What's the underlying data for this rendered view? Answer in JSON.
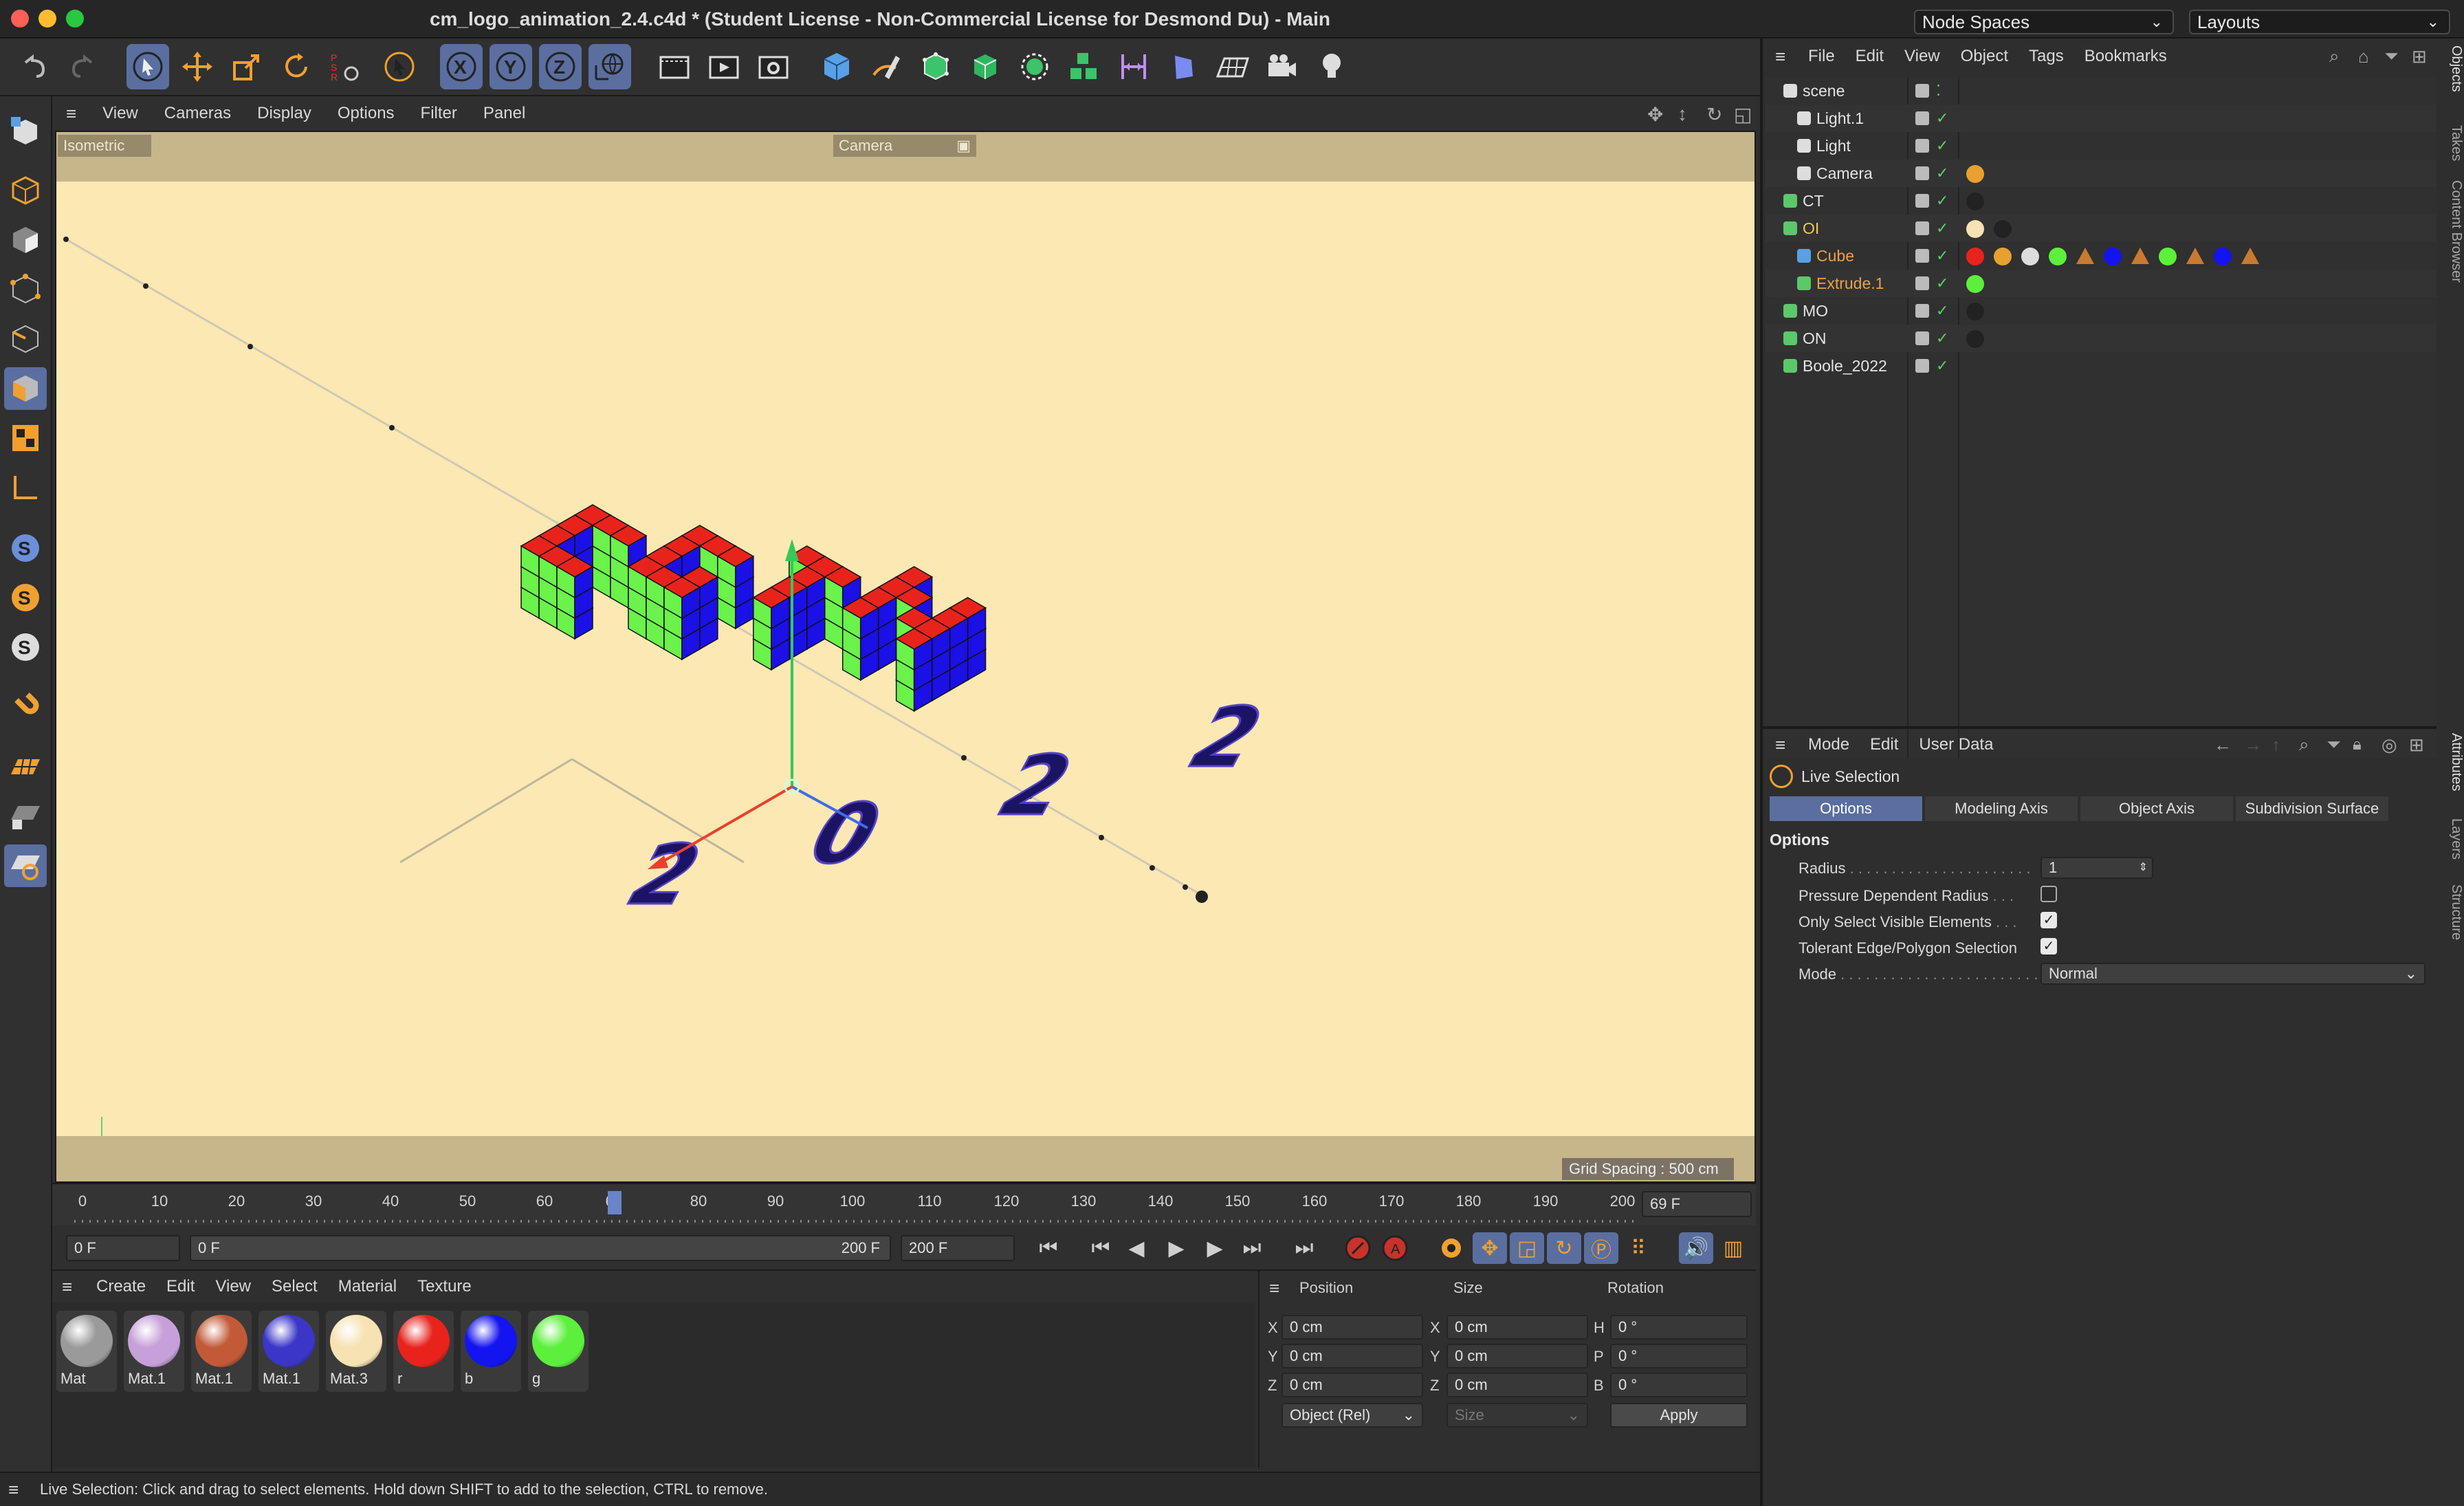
{
  "window": {
    "title": "cm_logo_animation_2.4.c4d * (Student License - Non-Commercial License for Desmond Du) - Main",
    "node_spaces": "Node Spaces",
    "layouts": "Layouts"
  },
  "viewport": {
    "menu": [
      "View",
      "Cameras",
      "Display",
      "Options",
      "Filter",
      "Panel"
    ],
    "projection": "Isometric",
    "camera": "Camera",
    "grid_spacing": "Grid Spacing : 500 cm",
    "logo_text": "2022",
    "colors": {
      "top": "#e8231c",
      "left": "#6bf24b",
      "right": "#1b10e6",
      "background": "#fbe8b2"
    }
  },
  "timeline": {
    "ticks": [
      "0",
      "10",
      "20",
      "30",
      "40",
      "50",
      "60",
      "69",
      "80",
      "90",
      "100",
      "110",
      "120",
      "130",
      "140",
      "150",
      "160",
      "170",
      "180",
      "190",
      "200"
    ],
    "current_frame": "69 F"
  },
  "playback": {
    "start": "0 F",
    "range_start": "0 F",
    "range_end": "200 F",
    "end": "200 F"
  },
  "materials": {
    "menu": [
      "Create",
      "Edit",
      "View",
      "Select",
      "Material",
      "Texture"
    ],
    "items": [
      {
        "name": "Mat",
        "color": "#9a9a9a"
      },
      {
        "name": "Mat.1",
        "color": "#c6a0d8"
      },
      {
        "name": "Mat.1",
        "color": "#c25a38"
      },
      {
        "name": "Mat.1",
        "color": "#3b36c8"
      },
      {
        "name": "Mat.3",
        "color": "#f6e2b2"
      },
      {
        "name": "r",
        "color": "#e8231c"
      },
      {
        "name": "b",
        "color": "#1414f0"
      },
      {
        "name": "g",
        "color": "#5cf03c"
      }
    ]
  },
  "coordinates": {
    "headers": [
      "Position",
      "Size",
      "Rotation"
    ],
    "rows": [
      {
        "axis": "X",
        "pos": "0 cm",
        "saxis": "X",
        "size": "0 cm",
        "raxis": "H",
        "rot": "0 °"
      },
      {
        "axis": "Y",
        "pos": "0 cm",
        "saxis": "Y",
        "size": "0 cm",
        "raxis": "P",
        "rot": "0 °"
      },
      {
        "axis": "Z",
        "pos": "0 cm",
        "saxis": "Z",
        "size": "0 cm",
        "raxis": "B",
        "rot": "0 °"
      }
    ],
    "mode": "Object (Rel)",
    "size_mode": "Size",
    "apply": "Apply"
  },
  "status": "Live Selection: Click and drag to select elements. Hold down SHIFT to add to the selection, CTRL to remove.",
  "objects": {
    "menu": [
      "File",
      "Edit",
      "View",
      "Object",
      "Tags",
      "Bookmarks"
    ],
    "rows": [
      {
        "name": "scene",
        "indent": 0,
        "color": "#e3e3e3"
      },
      {
        "name": "Light.1",
        "indent": 1,
        "color": "#e3e3e3"
      },
      {
        "name": "Light",
        "indent": 1,
        "color": "#e3e3e3"
      },
      {
        "name": "Camera",
        "indent": 1,
        "color": "#e3e3e3"
      },
      {
        "name": "CT",
        "indent": 0,
        "color": "#e3e3e3"
      },
      {
        "name": "OI",
        "indent": 0,
        "color": "#f2c84b"
      },
      {
        "name": "Cube",
        "indent": 1,
        "color": "#e8a24a"
      },
      {
        "name": "Extrude.1",
        "indent": 1,
        "color": "#e8a24a"
      },
      {
        "name": "MO",
        "indent": 0,
        "color": "#e3e3e3"
      },
      {
        "name": "ON",
        "indent": 0,
        "color": "#e3e3e3"
      },
      {
        "name": "Boole_2022",
        "indent": 0,
        "color": "#e3e3e3"
      }
    ],
    "side_tabs": [
      "Objects",
      "Takes",
      "Content Browser"
    ]
  },
  "attributes": {
    "menu": [
      "Mode",
      "Edit",
      "User Data"
    ],
    "tool": "Live Selection",
    "tabs": [
      "Options",
      "Modeling Axis",
      "Object Axis",
      "Subdivision Surface"
    ],
    "section": "Options",
    "radius_label": "Radius",
    "radius_value": "1",
    "pressure_label": "Pressure Dependent Radius",
    "visible_label": "Only Select Visible Elements",
    "tolerant_label": "Tolerant Edge/Polygon Selection",
    "mode_label": "Mode",
    "mode_value": "Normal",
    "side_tabs": [
      "Attributes",
      "Layers",
      "Structure"
    ]
  }
}
